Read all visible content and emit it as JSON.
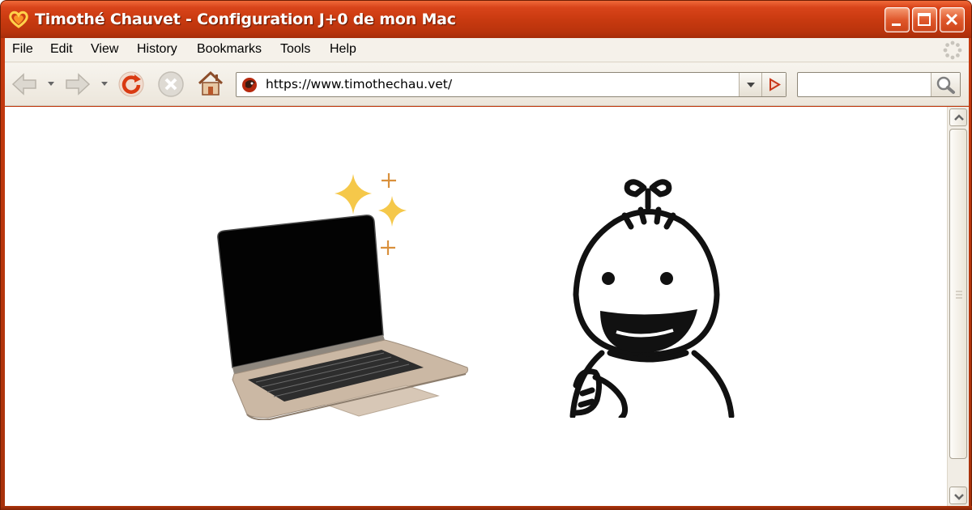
{
  "window": {
    "title": "Timothé Chauvet - Configuration J+0 de mon Mac",
    "controls": [
      "minimize",
      "maximize",
      "close"
    ]
  },
  "menu": {
    "items": [
      "File",
      "Edit",
      "View",
      "History",
      "Bookmarks",
      "Tools",
      "Help"
    ]
  },
  "navbar": {
    "url": "https://www.timothechau.vet/",
    "search_value": ""
  },
  "icons": {
    "back": "back-arrow-icon",
    "forward": "forward-arrow-icon",
    "reload": "reload-icon",
    "stop": "stop-icon",
    "home": "home-icon",
    "favicon": "site-favicon-icon",
    "go": "go-arrow-icon",
    "search": "magnifier-icon"
  },
  "colors": {
    "titlebar": "#c93a10",
    "chrome": "#f3efe7",
    "sparkle": "#f5c84a",
    "sparkle_small": "#d9903c"
  }
}
